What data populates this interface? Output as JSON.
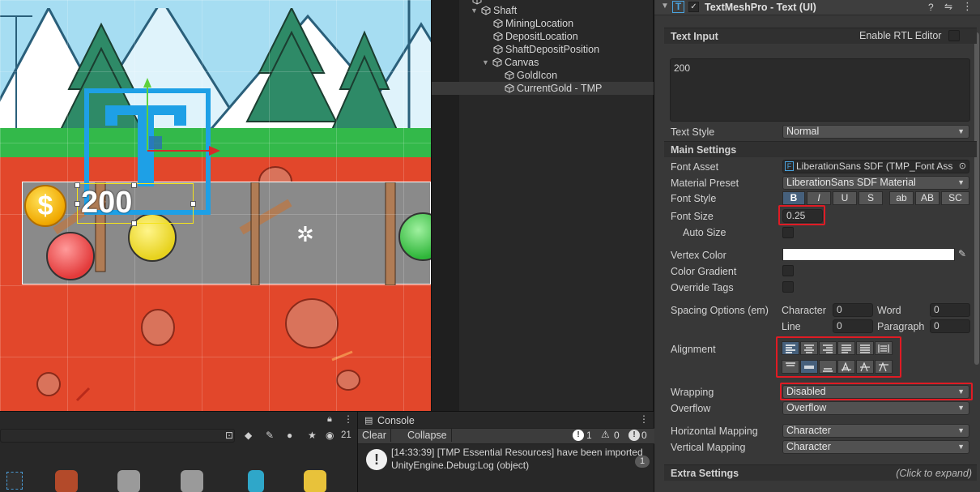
{
  "hierarchy": {
    "items": [
      {
        "label": "Shaft",
        "indent": 1,
        "foldable": true
      },
      {
        "label": "MiningLocation",
        "indent": 2
      },
      {
        "label": "DepositLocation",
        "indent": 2
      },
      {
        "label": "ShaftDepositPosition",
        "indent": 2
      },
      {
        "label": "Canvas",
        "indent": 2,
        "foldable": true
      },
      {
        "label": "GoldIcon",
        "indent": 3
      },
      {
        "label": "CurrentGold - TMP",
        "indent": 3,
        "selected": true
      }
    ]
  },
  "scene": {
    "gold_text": "200",
    "coin_symbol": "$"
  },
  "inspector": {
    "component_title": "TextMeshPro - Text (UI)",
    "text_input_header": "Text Input",
    "enable_rtl_label": "Enable RTL Editor",
    "text_value": "200",
    "text_style_label": "Text Style",
    "text_style_value": "Normal",
    "main_settings_header": "Main Settings",
    "font_asset_label": "Font Asset",
    "font_asset_value": "LiberationSans SDF (TMP_Font Ass",
    "material_preset_label": "Material Preset",
    "material_preset_value": "LiberationSans SDF Material",
    "font_style_label": "Font Style",
    "font_style_buttons": [
      "B",
      "I",
      "U",
      "S",
      "ab",
      "AB",
      "SC"
    ],
    "font_size_label": "Font Size",
    "font_size_value": "0.25",
    "auto_size_label": "Auto Size",
    "vertex_color_label": "Vertex Color",
    "color_gradient_label": "Color Gradient",
    "override_tags_label": "Override Tags",
    "spacing_label": "Spacing Options (em)",
    "spacing": {
      "character_label": "Character",
      "character_value": "0",
      "word_label": "Word",
      "word_value": "0",
      "line_label": "Line",
      "line_value": "0",
      "paragraph_label": "Paragraph",
      "paragraph_value": "0"
    },
    "alignment_label": "Alignment",
    "wrapping_label": "Wrapping",
    "wrapping_value": "Disabled",
    "overflow_label": "Overflow",
    "overflow_value": "Overflow",
    "horizontal_mapping_label": "Horizontal Mapping",
    "horizontal_mapping_value": "Character",
    "vertical_mapping_label": "Vertical Mapping",
    "vertical_mapping_value": "Character",
    "extra_settings_header": "Extra Settings",
    "extra_settings_hint": "(Click to expand)"
  },
  "project": {
    "count_badge": "21"
  },
  "console": {
    "tab_label": "Console",
    "clear_label": "Clear",
    "collapse_label": "Collapse",
    "info_count": "1",
    "warning_count": "0",
    "error_count": "0",
    "log_line1": "[14:33:39] [TMP Essential Resources] have been imported",
    "log_line2": "UnityEngine.Debug:Log (object)",
    "log_count": "1"
  },
  "colors": {
    "accent_selected": "#46607c",
    "highlight_red": "#e01b24",
    "gizmo_blue": "#1ea0e6"
  }
}
